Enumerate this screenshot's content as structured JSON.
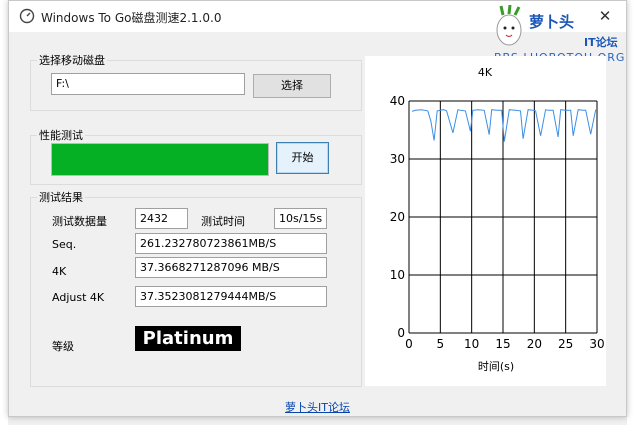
{
  "app": {
    "title": "Windows To Go磁盘测速2.1.0.0",
    "close_glyph": "✕"
  },
  "logo": {
    "name": "萝卜头",
    "tag": "IT论坛",
    "url": "BBS.LUOBOTOU.ORG"
  },
  "drive_group": {
    "legend": "选择移动磁盘",
    "path_value": "F:\\",
    "select_button": "选择"
  },
  "perf_group": {
    "legend": "性能测试",
    "progress_percent": 100,
    "start_button": "开始"
  },
  "results": {
    "legend": "测试结果",
    "data_size_label": "测试数据量",
    "data_size_value": "2432",
    "time_label": "测试时间",
    "time_value": "10s/15s",
    "seq_label": "Seq.",
    "seq_value": "261.232780723861MB/S",
    "k4_label": "4K",
    "k4_value": "37.3668271287096 MB/S",
    "adj_label": "Adjust 4K",
    "adj_value": "37.3523081279444MB/S",
    "grade_label": "等级",
    "grade_value": "Platinum"
  },
  "footer": {
    "link": "萝卜头IT论坛"
  },
  "colors": {
    "progress": "#06b025",
    "line": "#3c8ee6",
    "grade_bg": "#000000"
  },
  "chart_data": {
    "type": "line",
    "title": "4K",
    "xlabel": "时间(s)",
    "ylabel": "",
    "xlim": [
      0,
      30
    ],
    "ylim": [
      0,
      40
    ],
    "x_ticks": [
      0,
      5,
      10,
      15,
      20,
      25,
      30
    ],
    "y_ticks": [
      0,
      10,
      20,
      30,
      40
    ],
    "grid": true,
    "series": [
      {
        "x": [
          0.5,
          1,
          2,
          3,
          3.5,
          4,
          4.5,
          5,
          5.5,
          6,
          7,
          7.8,
          8.2,
          9,
          9.8,
          10.2,
          11,
          12,
          12.8,
          13.2,
          14,
          14.8,
          15.2,
          16,
          17,
          17.8,
          18.2,
          19,
          19.8,
          20.2,
          21,
          21.8,
          22.2,
          23,
          23.8,
          24.2,
          25,
          25.8,
          26.2,
          27,
          27.8,
          28.2,
          29,
          29.8
        ],
        "y": [
          38.2,
          38.4,
          38.5,
          38.3,
          36.5,
          33.2,
          38.3,
          38.4,
          38.5,
          38.3,
          34.5,
          38.5,
          38.4,
          38.3,
          34.8,
          38.4,
          38.5,
          38.4,
          34.2,
          38.5,
          38.4,
          38.4,
          33.0,
          38.5,
          38.4,
          38.3,
          33.5,
          38.5,
          38.4,
          38.3,
          34.0,
          38.5,
          38.4,
          38.4,
          33.8,
          38.5,
          38.4,
          38.4,
          34.0,
          38.5,
          38.4,
          38.4,
          34.3,
          38.5
        ]
      }
    ]
  }
}
